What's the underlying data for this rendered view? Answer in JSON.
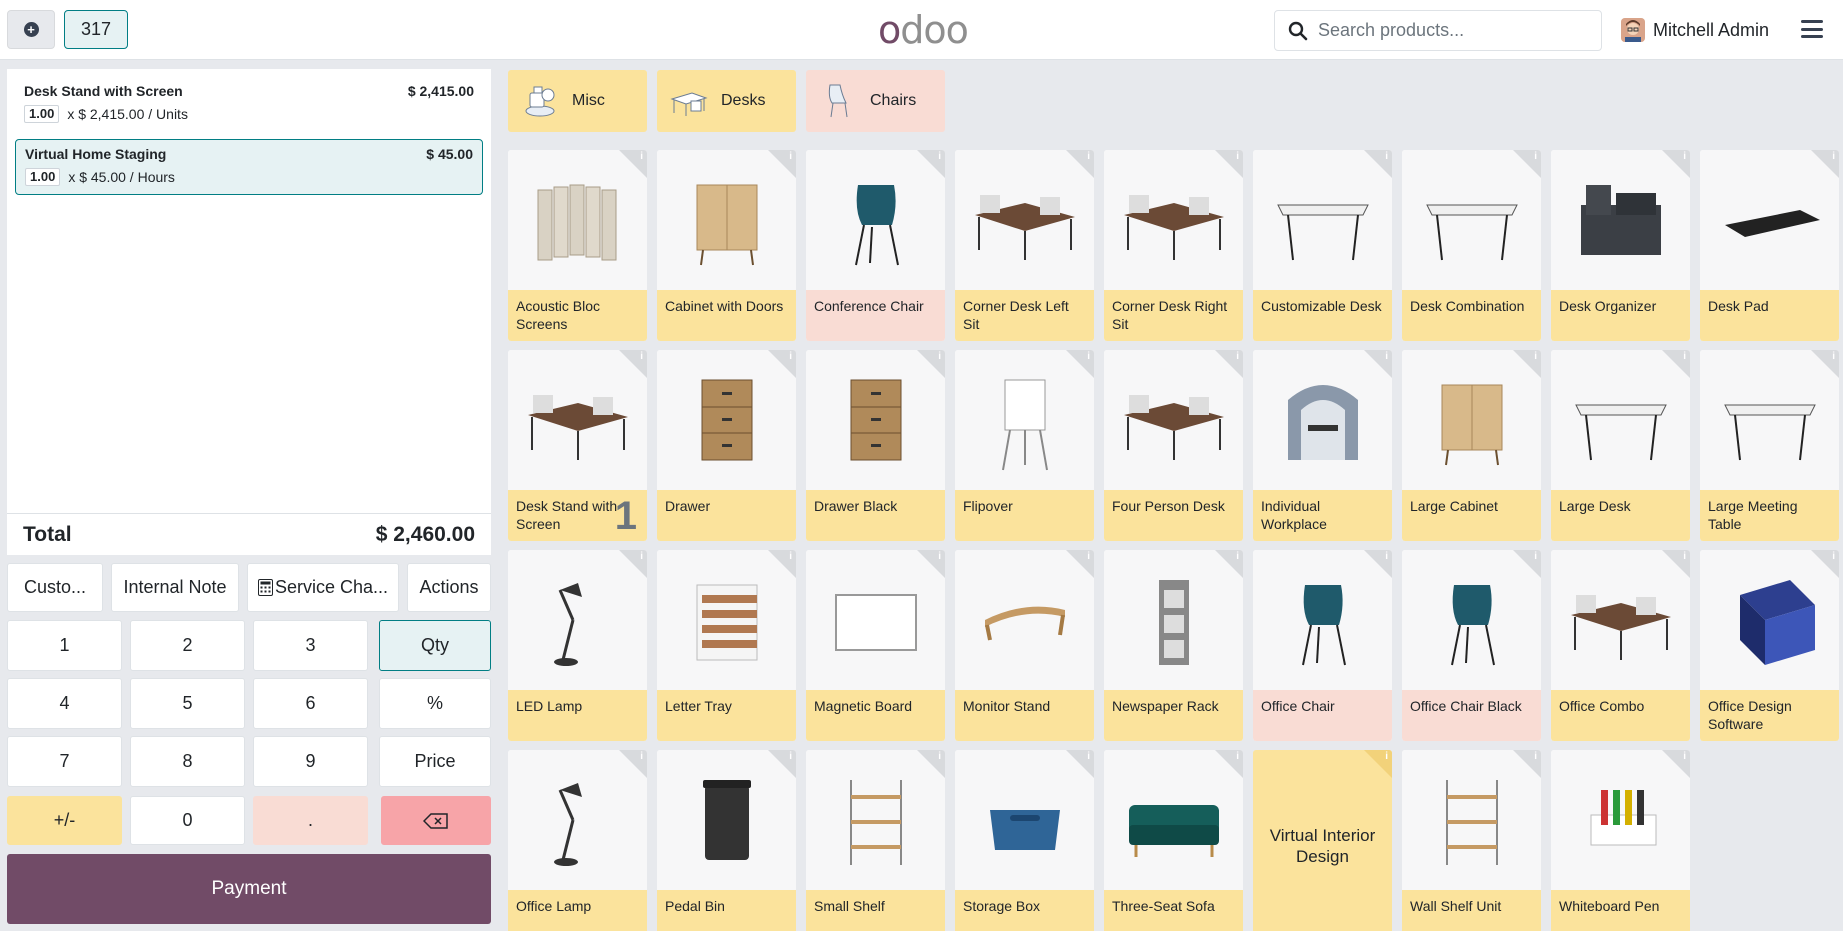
{
  "topbar": {
    "order_number": "317",
    "logo": "odoo",
    "search_placeholder": "Search products...",
    "user_name": "Mitchell Admin"
  },
  "order": {
    "lines": [
      {
        "name": "Desk Stand with Screen",
        "price": "$ 2,415.00",
        "qty": "1.00",
        "unit": "x $ 2,415.00 / Units",
        "selected": false
      },
      {
        "name": "Virtual Home Staging",
        "price": "$ 45.00",
        "qty": "1.00",
        "unit": "x $ 45.00 / Hours",
        "selected": true
      }
    ],
    "total_label": "Total",
    "total_value": "$ 2,460.00"
  },
  "controls": {
    "customer": "Custo...",
    "internal_note": "Internal Note",
    "service_charge": "Service Cha...",
    "actions": "Actions"
  },
  "numpad": {
    "keys": [
      "1",
      "2",
      "3",
      "Qty",
      "4",
      "5",
      "6",
      "%",
      "7",
      "8",
      "9",
      "Price",
      "+/-",
      "0",
      ".",
      "⌫"
    ]
  },
  "payment_label": "Payment",
  "categories": [
    {
      "label": "Misc",
      "icon": "misc-icon",
      "color": "#fbe39c"
    },
    {
      "label": "Desks",
      "icon": "desk-icon",
      "color": "#fbe39c"
    },
    {
      "label": "Chairs",
      "icon": "chair-icon",
      "color": "#f9dcd4"
    }
  ],
  "products": [
    {
      "name": "Acoustic Bloc Screens",
      "icon": "screen-icon",
      "pink": false
    },
    {
      "name": "Cabinet with Doors",
      "icon": "cabinet-icon",
      "pink": false
    },
    {
      "name": "Conference Chair",
      "icon": "chair-icon",
      "pink": true
    },
    {
      "name": "Corner Desk Left Sit",
      "icon": "desk-icon",
      "pink": false
    },
    {
      "name": "Corner Desk Right Sit",
      "icon": "desk-icon",
      "pink": false
    },
    {
      "name": "Customizable Desk",
      "icon": "table-icon",
      "pink": false
    },
    {
      "name": "Desk Combination",
      "icon": "table-icon",
      "pink": false
    },
    {
      "name": "Desk Organizer",
      "icon": "organizer-icon",
      "pink": false
    },
    {
      "name": "Desk Pad",
      "icon": "pad-icon",
      "pink": false
    },
    {
      "name": "Desk Stand with Screen",
      "icon": "desk-icon",
      "pink": false,
      "qty": "1"
    },
    {
      "name": "Drawer",
      "icon": "drawer-icon",
      "pink": false
    },
    {
      "name": "Drawer Black",
      "icon": "drawer-icon",
      "pink": false
    },
    {
      "name": "Flipover",
      "icon": "flipchart-icon",
      "pink": false
    },
    {
      "name": "Four Person Desk",
      "icon": "desk-icon",
      "pink": false
    },
    {
      "name": "Individual Workplace",
      "icon": "pod-icon",
      "pink": false
    },
    {
      "name": "Large Cabinet",
      "icon": "cabinet-icon",
      "pink": false
    },
    {
      "name": "Large Desk",
      "icon": "table-icon",
      "pink": false
    },
    {
      "name": "Large Meeting Table",
      "icon": "table-icon",
      "pink": false
    },
    {
      "name": "LED Lamp",
      "icon": "lamp-icon",
      "pink": false
    },
    {
      "name": "Letter Tray",
      "icon": "tray-icon",
      "pink": false
    },
    {
      "name": "Magnetic Board",
      "icon": "board-icon",
      "pink": false
    },
    {
      "name": "Monitor Stand",
      "icon": "stand-icon",
      "pink": false
    },
    {
      "name": "Newspaper Rack",
      "icon": "rack-icon",
      "pink": false
    },
    {
      "name": "Office Chair",
      "icon": "chair-icon",
      "pink": true
    },
    {
      "name": "Office Chair Black",
      "icon": "chair-icon",
      "pink": true
    },
    {
      "name": "Office Combo",
      "icon": "desk-icon",
      "pink": false
    },
    {
      "name": "Office Design Software",
      "icon": "software-box-icon",
      "pink": false
    },
    {
      "name": "Office Lamp",
      "icon": "lamp-icon",
      "pink": false
    },
    {
      "name": "Pedal Bin",
      "icon": "bin-icon",
      "pink": false
    },
    {
      "name": "Small Shelf",
      "icon": "shelf-icon",
      "pink": false
    },
    {
      "name": "Storage Box",
      "icon": "box-icon",
      "pink": false
    },
    {
      "name": "Three-Seat Sofa",
      "icon": "sofa-icon",
      "pink": false
    },
    {
      "name": "Virtual Interior Design",
      "icon": "",
      "pink": false,
      "no_image": true
    },
    {
      "name": "Wall Shelf Unit",
      "icon": "shelf-icon",
      "pink": false
    },
    {
      "name": "Whiteboard Pen",
      "icon": "pen-icon",
      "pink": false
    }
  ],
  "colors": {
    "brand": "#714b67",
    "accent": "#017e84",
    "product_yellow": "#fbe39c",
    "product_pink": "#f9dcd4",
    "backspace": "#f7a4a8"
  }
}
